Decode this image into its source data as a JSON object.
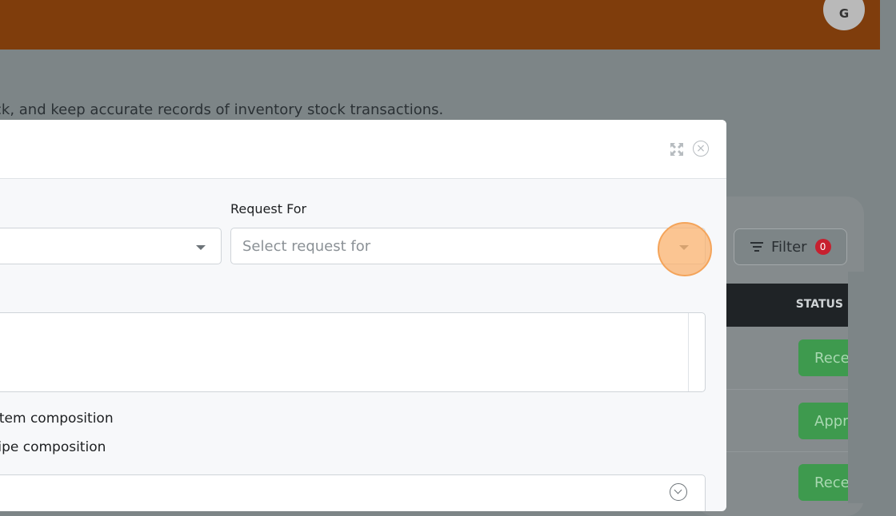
{
  "header": {
    "avatar_initial": "G"
  },
  "page": {
    "description": "ck, and keep accurate records of inventory stock transactions."
  },
  "toolbar": {
    "filter_label": "Filter",
    "filter_count": "0"
  },
  "table": {
    "status_header": "STATUS",
    "status_rows": [
      "Rece",
      "Appr",
      "Rece"
    ]
  },
  "modal": {
    "request_for_label": "Request For",
    "request_for_placeholder": "Select request for",
    "option_sub_item": "-item composition",
    "option_recipe": "cipe composition"
  },
  "colors": {
    "topbar": "#7f3d0c",
    "status_green": "#3e9a4e",
    "badge_red": "#c7202f",
    "click_highlight": "#f9b26e"
  },
  "icons": [
    "expand-icon",
    "close-icon",
    "filter-icon",
    "caret-down-icon",
    "chevron-down-icon"
  ]
}
